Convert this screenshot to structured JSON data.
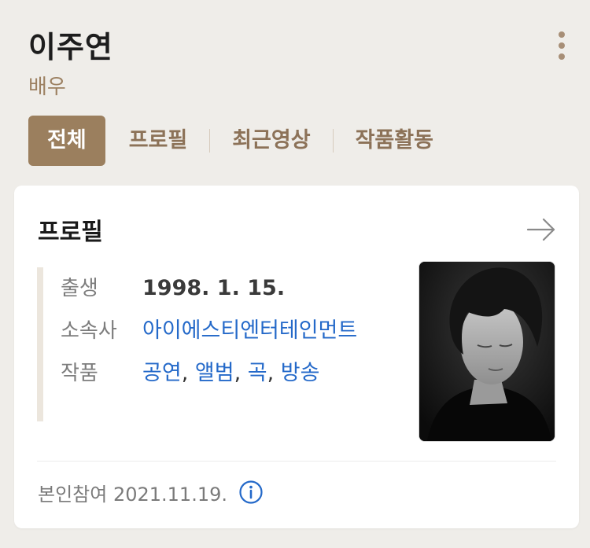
{
  "person": {
    "name": "이주연",
    "role": "배우"
  },
  "tabs": [
    {
      "label": "전체",
      "active": true
    },
    {
      "label": "프로필",
      "active": false
    },
    {
      "label": "최근영상",
      "active": false
    },
    {
      "label": "작품활동",
      "active": false
    }
  ],
  "profile_card": {
    "title": "프로필",
    "rows": [
      {
        "label": "출생",
        "value": "1998. 1. 15."
      },
      {
        "label": "소속사",
        "value": "아이에스티엔터테인먼트"
      },
      {
        "label": "작품",
        "links": [
          "공연",
          "앨범",
          "곡",
          "방송"
        ],
        "separator": ","
      }
    ],
    "photo_alt": "프로필 사진",
    "footer_text": "본인참여 2021.11.19."
  },
  "icons": {
    "more": "more-vertical-icon",
    "arrow": "arrow-right-icon",
    "info": "info-circle-icon"
  },
  "colors": {
    "background": "#efede9",
    "accent": "#9b7f5e",
    "tab_text": "#8c7258",
    "link": "#2469c9"
  }
}
